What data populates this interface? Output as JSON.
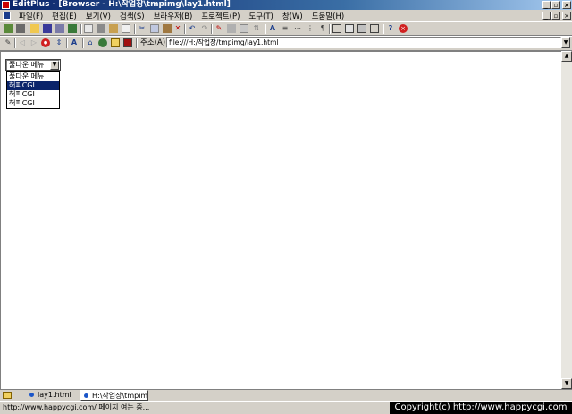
{
  "window": {
    "title": "EditPlus - [Browser - H:\\작업장\\tmpimg\\lay1.html]",
    "min": "_",
    "max": "▫",
    "close": "×"
  },
  "menu": {
    "items": [
      "파일(F)",
      "편집(E)",
      "보기(V)",
      "검색(S)",
      "브라우저(B)",
      "프로젝트(P)",
      "도구(T)",
      "창(W)",
      "도움말(H)"
    ]
  },
  "address": {
    "label": "주소(A)",
    "value": "file:///H:/작업장/tmpimg/lay1.html"
  },
  "page": {
    "select_value": "풀다운 메뉴",
    "options": [
      "풀다운 메뉴",
      "해피CGI",
      "해피CGI",
      "해피CGI"
    ],
    "selected_index": 1
  },
  "tabs": [
    "lay1.html",
    "H:\\작업장\\tmpimg"
  ],
  "status": {
    "text": "http://www.happycgi.com/ 페이지 여는 중...",
    "copyright": "Copyright(c) http://www.happycgi.com"
  },
  "colors": {
    "title_start": "#0a246a",
    "selection": "#0a246a",
    "chrome": "#d4d0c8"
  }
}
